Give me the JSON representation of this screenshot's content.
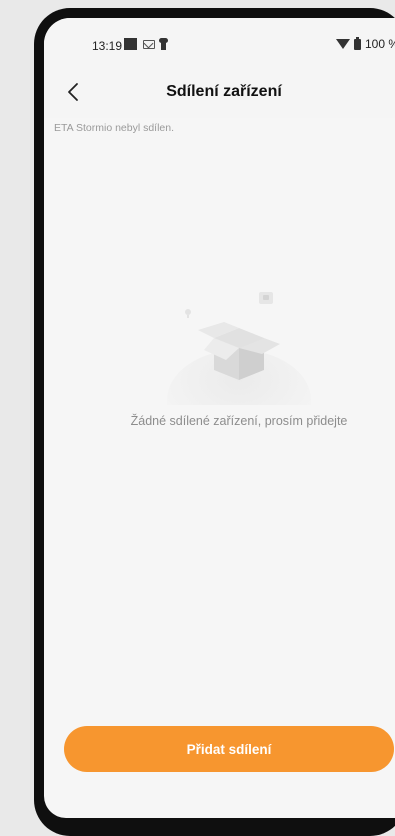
{
  "status_bar": {
    "time": "13:19",
    "battery": "100 %",
    "icons": [
      "square-notification-icon",
      "mail-icon",
      "key-icon",
      "wifi-icon",
      "battery-icon"
    ]
  },
  "header": {
    "title": "Sdílení zařízení",
    "back_icon": "chevron-left-icon"
  },
  "main": {
    "notice": "ETA Stormio  nebyl sdílen.",
    "empty_state": {
      "illustration": "empty-box-illustration",
      "message": "Žádné sdílené zařízení, prosím přidejte"
    }
  },
  "footer": {
    "add_button_label": "Přidat sdílení"
  },
  "colors": {
    "accent": "#f7962f",
    "background": "#f6f6f6",
    "frame": "#0f0f0f"
  }
}
